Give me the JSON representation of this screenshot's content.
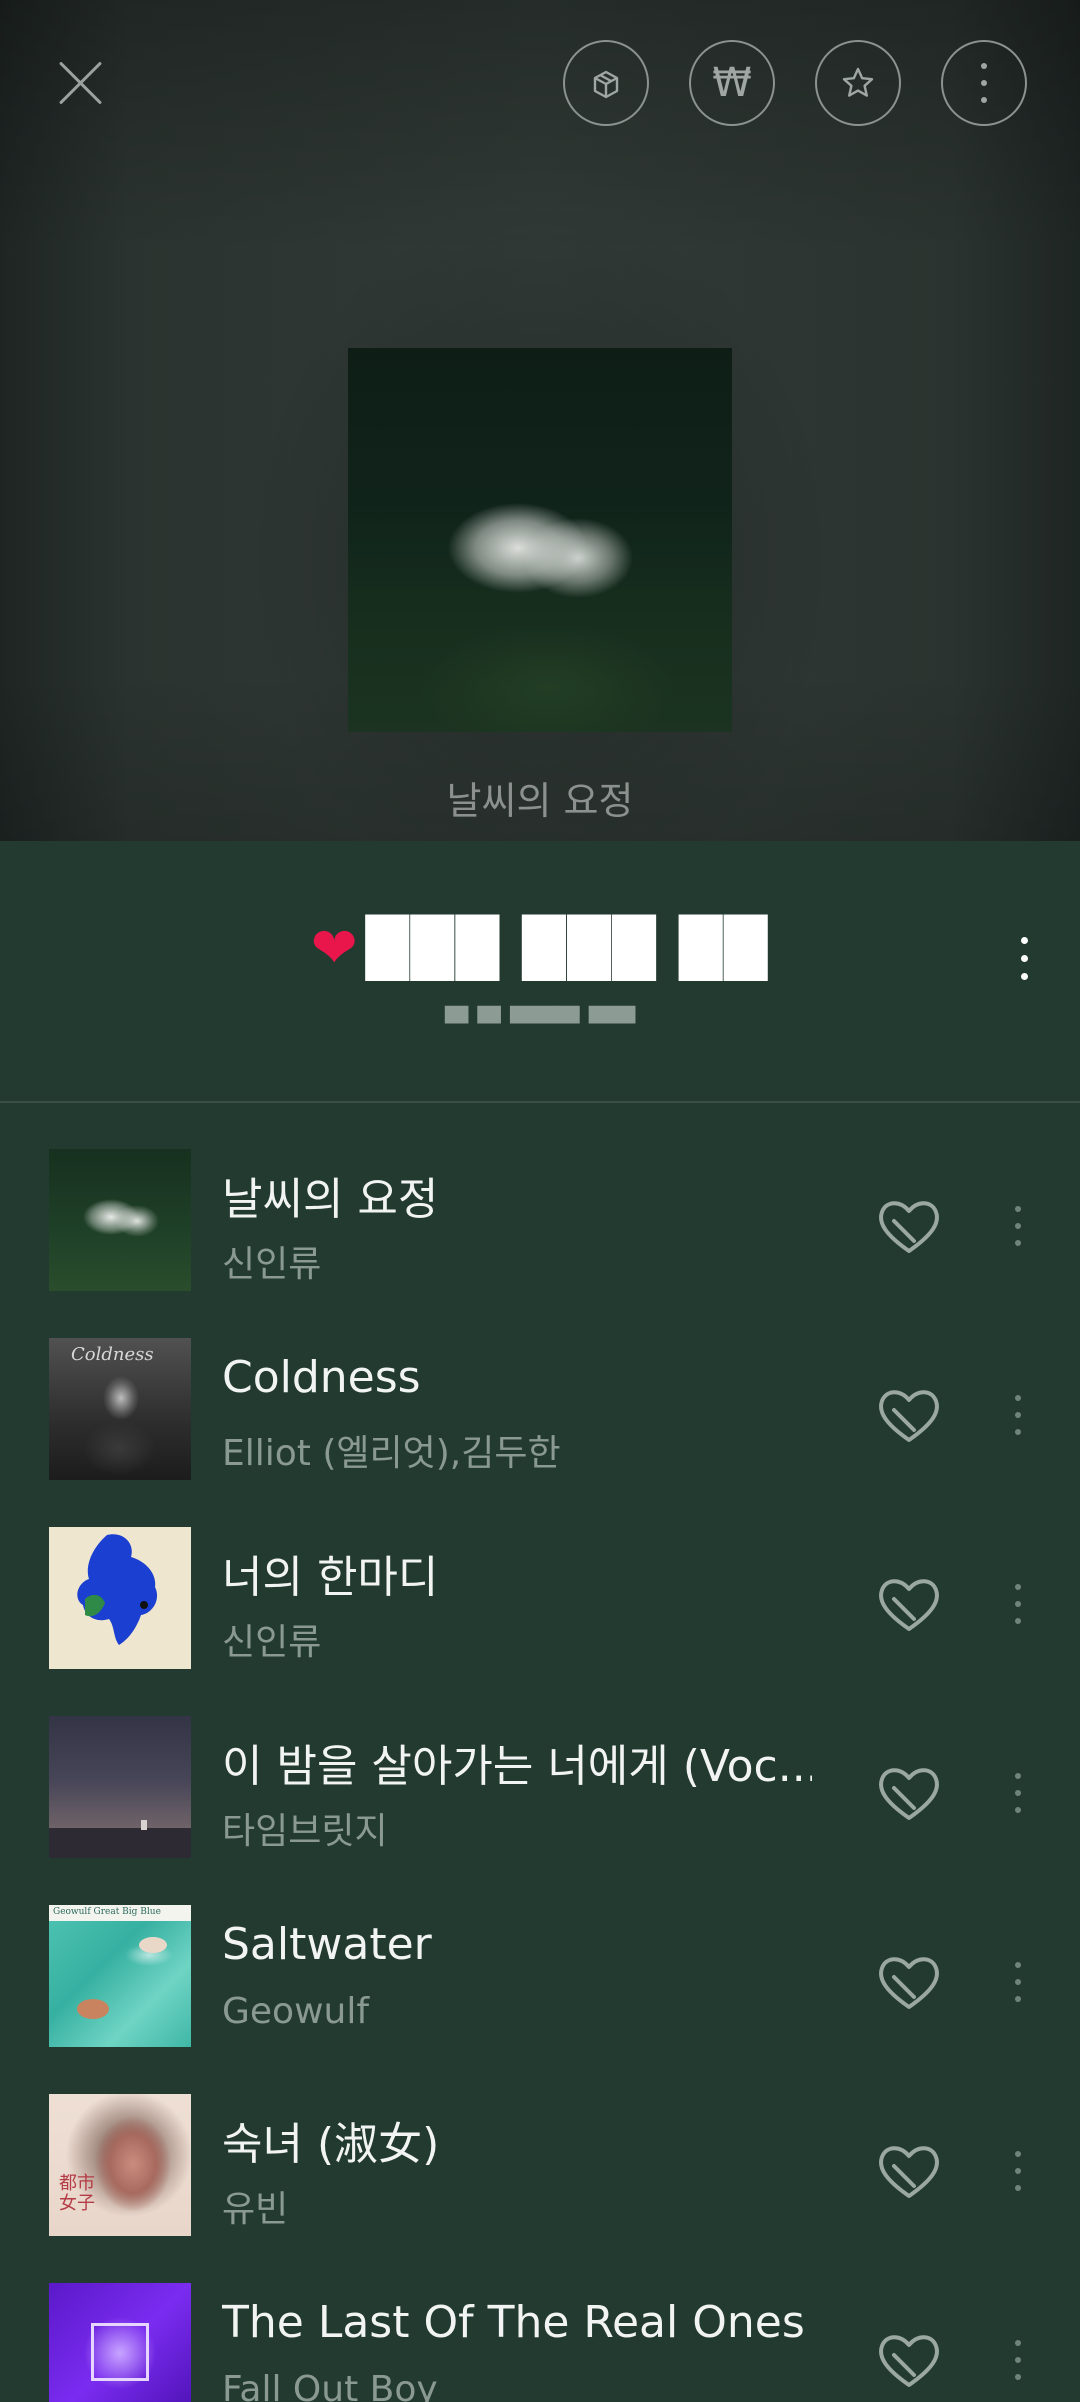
{
  "header_actions": {
    "close": "close-icon",
    "gift": "gift-box-icon",
    "won_symbol": "₩",
    "favorite": "star-icon",
    "more": "more-vertical-icon"
  },
  "now_playing": {
    "caption": "날씨의 요정"
  },
  "playlist": {
    "title_heart": "❤",
    "title": "███ ███ ██",
    "subtitle": "▄ ▄ ▄▄▄ ▄▄"
  },
  "tracks": [
    {
      "title": "날씨의 요정",
      "artist": "신인류"
    },
    {
      "title": "Coldness",
      "artist": "Elliot (엘리엇),김두한",
      "thumb_text": "Coldness"
    },
    {
      "title": "너의 한마디",
      "artist": "신인류"
    },
    {
      "title": "이 밤을 살아가는 너에게 (Voc...",
      "artist": "타임브릿지"
    },
    {
      "title": "Saltwater",
      "artist": "Geowulf",
      "thumb_text": "Geowulf   Great Big Blue"
    },
    {
      "title": "숙녀 (淑女)",
      "artist": "유빈",
      "thumb_text": "都市女子"
    },
    {
      "title": "The Last Of The Real Ones",
      "artist": "Fall Out Boy"
    }
  ],
  "colors": {
    "background": "#233a31",
    "accent_heart": "#e8164a"
  }
}
